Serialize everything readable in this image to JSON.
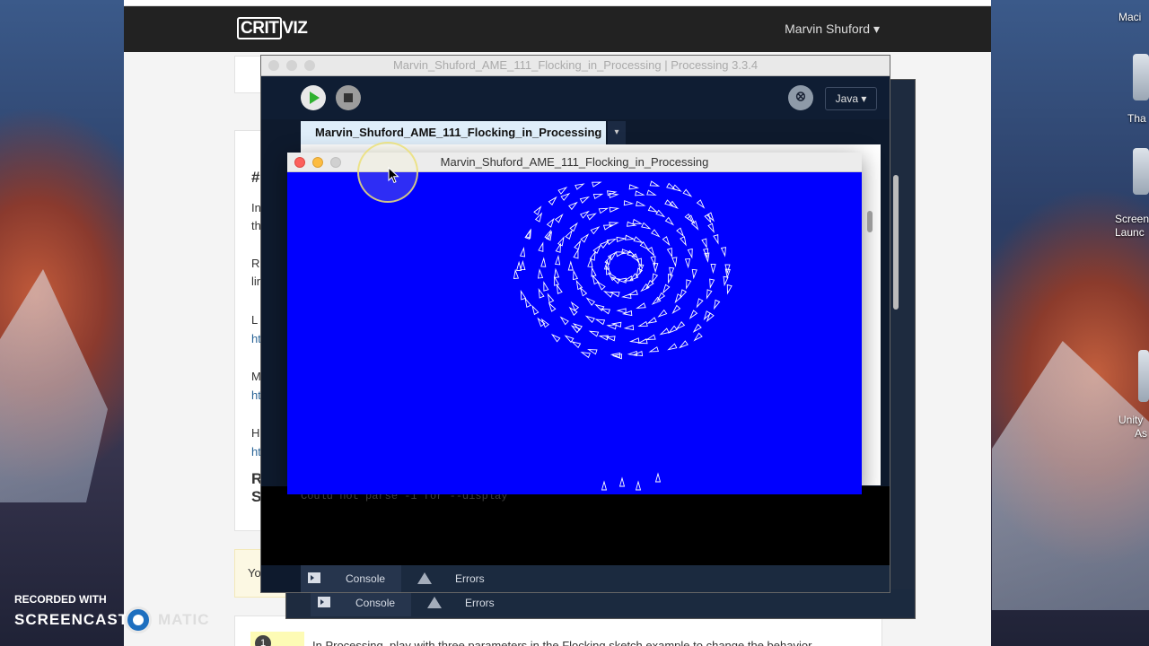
{
  "browser": {
    "logo_text_a": "CRIT",
    "logo_text_b": "VIZ",
    "user_menu": "Marvin Shuford ▾",
    "partial_texts": [
      "#",
      "In",
      "th",
      "R",
      "lin",
      "L",
      "ht",
      "M",
      "ht",
      "H",
      "ht",
      "R",
      "S",
      "Yo"
    ],
    "step_number": "1",
    "step_text": "In Processing, play with three parameters in the Flocking sketch example to change the behavior"
  },
  "ide": {
    "window_title": "Marvin_Shuford_AME_111_Flocking_in_Processing | Processing 3.3.4",
    "tab_label": "Marvin_Shuford_AME_111_Flocking_in_Processing",
    "tab_menu_glyph": "▾",
    "mode_label": "Java ▾",
    "debug_glyph": "ꕕ",
    "console_text": "Could not parse -1 for --display",
    "footer": {
      "console_label": "Console",
      "errors_label": "Errors"
    }
  },
  "sketch": {
    "title": "Marvin_Shuford_AME_111_Flocking_in_Processing",
    "background": "#0000ff",
    "boid_color": "#ffffff"
  },
  "desktop": {
    "labels": [
      "Maci",
      "Tha",
      "Screen",
      "Launc",
      "Unity",
      "As"
    ]
  },
  "watermark": {
    "line1": "RECORDED WITH",
    "line2a": "SCREENCAST",
    "line2b": "MATIC"
  }
}
